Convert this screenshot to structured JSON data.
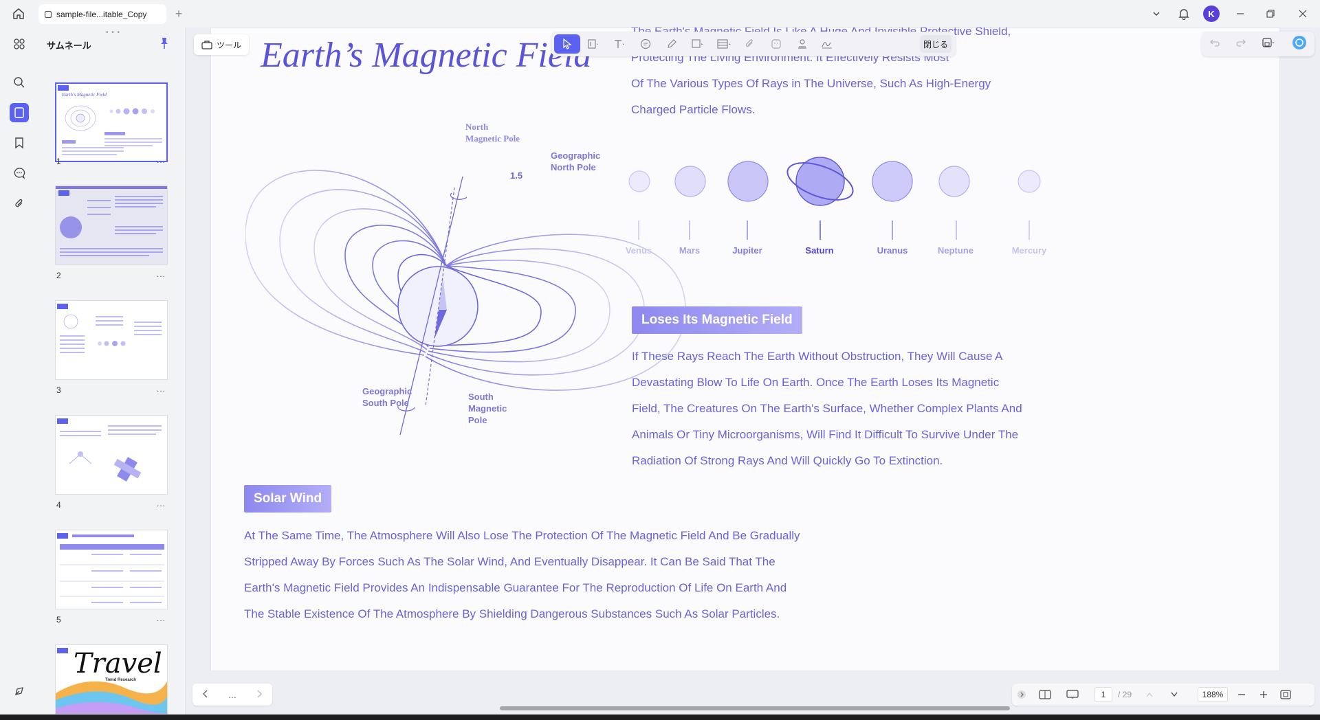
{
  "window": {
    "tab_title": "sample-file...itable_Copy",
    "new_tab": "+",
    "avatar_letter": "K",
    "accent": "#5b62f0"
  },
  "sidebar": {
    "title": "サムネール",
    "pages": [
      {
        "num": "1",
        "menu": "..."
      },
      {
        "num": "2",
        "menu": "..."
      },
      {
        "num": "3",
        "menu": "..."
      },
      {
        "num": "4",
        "menu": "..."
      },
      {
        "num": "5",
        "menu": "..."
      }
    ],
    "thumb6_word": "Travel",
    "thumb6_sub": "Trend Research"
  },
  "toolbar": {
    "tools_label": "ツール",
    "close_label": "閉じる"
  },
  "document": {
    "title": "Earth’s Magnetic Field",
    "top_paragraph_lines": [
      "The Earth's Magnetic Field Is Like A Huge And Invisible Protective Shield,",
      "Protecting The Living Environment. It Effectively Resists Most",
      "Of The Various Types Of Rays in The Universe, Such As High-Energy",
      "Charged Particle Flows."
    ],
    "diagram_labels": {
      "north_magnetic": "North\nMagnetic Pole",
      "geo_north": "Geographic\nNorth Pole",
      "angle": "1.5",
      "geo_south": "Geographic\nSouth Pole",
      "south_magnetic": "South\nMagnetic\nPole"
    },
    "planets": [
      "Venus",
      "Mars",
      "Jupiter",
      "Saturn",
      "Uranus",
      "Neptune",
      "Mercury"
    ],
    "section1_heading": "Loses Its Magnetic Field",
    "section1_lines": [
      "If These Rays Reach The Earth Without Obstruction, They Will Cause A",
      "Devastating Blow To Life On Earth. Once The Earth Loses Its Magnetic",
      "Field, The Creatures On The Earth's Surface, Whether Complex Plants And",
      "Animals Or Tiny Microorganisms, Will Find It Difficult To Survive Under The",
      "Radiation Of Strong Rays And Will Quickly Go To Extinction."
    ],
    "section2_heading": "Solar Wind",
    "section2_lines": [
      "At The Same Time, The Atmosphere Will Also Lose The Protection Of The Magnetic Field And Be Gradually",
      "Stripped Away By Forces Such As The Solar Wind, And Eventually Disappear. It Can Be Said That The",
      "Earth's Magnetic Field Provides An Indispensable Guarantee For The Reproduction Of Life On Earth And",
      "The Stable Existence Of The Atmosphere By Shielding Dangerous Substances Such As Solar Particles."
    ]
  },
  "footer": {
    "more": "...",
    "current_page": "1",
    "total_pages": "/ 29",
    "zoom": "188%"
  }
}
